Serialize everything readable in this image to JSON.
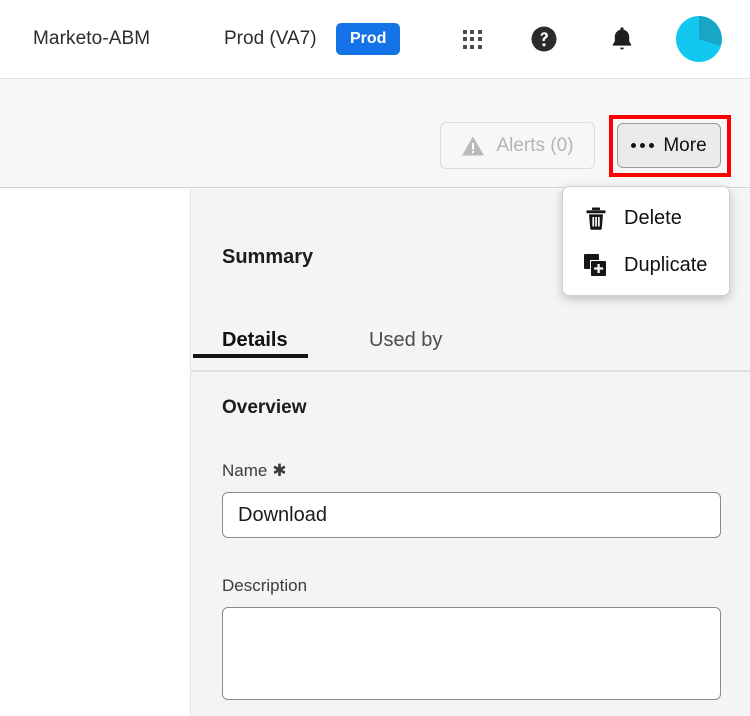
{
  "topbar": {
    "brand": "Marketo-ABM",
    "org": "Prod (VA7)",
    "env_badge": "Prod",
    "apps_icon": "grid-apps-icon",
    "help_icon": "help-circle-icon",
    "bell_icon": "notification-bell-icon",
    "avatar_icon": "user-avatar",
    "badge_color": "#1473e6",
    "avatar_color": "#12c8f0",
    "avatar_accent_color": "#0a9fc4"
  },
  "toolbar": {
    "alerts_label": "Alerts (0)",
    "alerts_icon": "warning-triangle-icon",
    "alerts_disabled": true,
    "more_label": "More",
    "more_icon": "ellipsis-icon",
    "highlight_color": "#ff0000"
  },
  "menu": {
    "items": [
      {
        "label": "Delete",
        "icon": "trash-icon"
      },
      {
        "label": "Duplicate",
        "icon": "duplicate-icon"
      }
    ]
  },
  "panel": {
    "title": "Summary",
    "tabs": [
      {
        "label": "Details",
        "active": true
      },
      {
        "label": "Used by",
        "active": false
      }
    ],
    "section_title": "Overview",
    "fields": {
      "name_label": "Name",
      "name_required_mark": "✱",
      "name_value": "Download",
      "name_placeholder": "",
      "description_label": "Description",
      "description_value": "",
      "description_placeholder": ""
    }
  }
}
